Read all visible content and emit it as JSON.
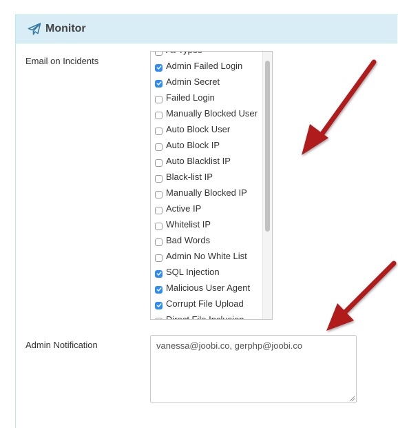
{
  "panel": {
    "title": "Monitor",
    "icon": "paper-plane-icon"
  },
  "email_on_incidents": {
    "label": "Email on Incidents",
    "scroll_position_fraction": 0.03,
    "visible_fraction": 0.64,
    "options": [
      {
        "label": "All Types",
        "checked": false
      },
      {
        "label": "Admin Failed Login",
        "checked": true
      },
      {
        "label": "Admin Secret",
        "checked": true
      },
      {
        "label": "Failed Login",
        "checked": false
      },
      {
        "label": "Manually Blocked User",
        "checked": false
      },
      {
        "label": "Auto Block User",
        "checked": false
      },
      {
        "label": "Auto Block IP",
        "checked": false
      },
      {
        "label": "Auto Blacklist IP",
        "checked": false
      },
      {
        "label": "Black-list IP",
        "checked": false
      },
      {
        "label": "Manually Blocked IP",
        "checked": false
      },
      {
        "label": "Active IP",
        "checked": false
      },
      {
        "label": "Whitelist IP",
        "checked": false
      },
      {
        "label": "Bad Words",
        "checked": false
      },
      {
        "label": "Admin No White List",
        "checked": false
      },
      {
        "label": "SQL Injection",
        "checked": true
      },
      {
        "label": "Malicious User Agent",
        "checked": true
      },
      {
        "label": "Corrupt File Upload",
        "checked": true
      },
      {
        "label": "Direct File Inclusion",
        "checked": false
      }
    ]
  },
  "admin_notification": {
    "label": "Admin Notification",
    "value": "vanessa@joobi.co, gerphp@joobi.co"
  },
  "annotations": {
    "arrow_color": "#b01a1a",
    "arrows": [
      "pointing-to-incident-list",
      "pointing-to-notification-field"
    ]
  },
  "colors": {
    "heading_bg": "#d9edf7",
    "heading_border": "#bce8f1",
    "checkbox_checked": "#2f8cf3"
  }
}
